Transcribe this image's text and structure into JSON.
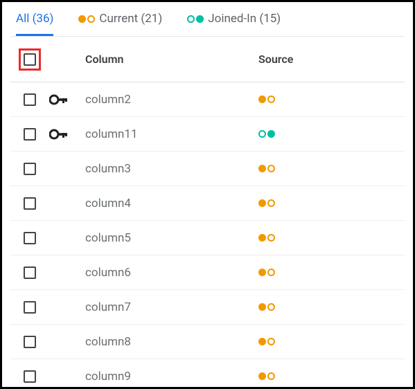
{
  "tabs": [
    {
      "label": "All (36)",
      "active": true,
      "dots": null
    },
    {
      "label": "Current (21)",
      "active": false,
      "dots": "current"
    },
    {
      "label": "Joined-In (15)",
      "active": false,
      "dots": "joined"
    }
  ],
  "headers": {
    "column": "Column",
    "source": "Source"
  },
  "rows": [
    {
      "name": "column2",
      "key": true,
      "source": "current"
    },
    {
      "name": "column11",
      "key": true,
      "source": "joined"
    },
    {
      "name": "column3",
      "key": false,
      "source": "current"
    },
    {
      "name": "column4",
      "key": false,
      "source": "current"
    },
    {
      "name": "column5",
      "key": false,
      "source": "current"
    },
    {
      "name": "column6",
      "key": false,
      "source": "current"
    },
    {
      "name": "column7",
      "key": false,
      "source": "current"
    },
    {
      "name": "column8",
      "key": false,
      "source": "current"
    },
    {
      "name": "column9",
      "key": false,
      "source": "current"
    }
  ]
}
